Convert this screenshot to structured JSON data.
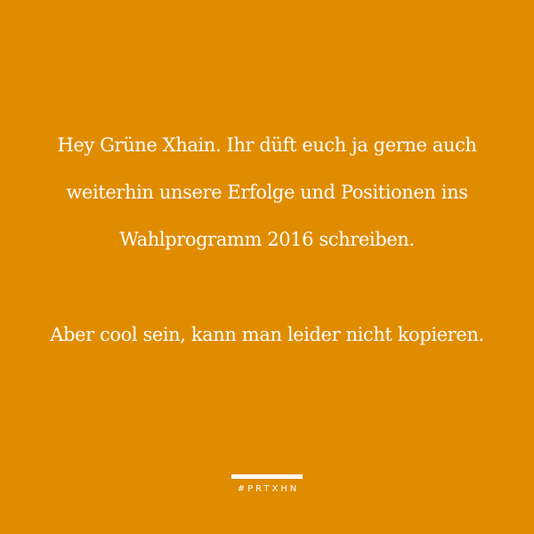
{
  "colors": {
    "background": "#E08C00",
    "text": "#FFFFFF"
  },
  "quote": {
    "paragraph1": [
      "Hey Grüne Xhain. Ihr düft euch ja gerne auch",
      "weiterhin unsere Erfolge und Positionen ins",
      "Wahlprogramm 2016 schreiben."
    ],
    "paragraph2": [
      "Aber cool sein, kann man leider nicht kopieren."
    ]
  },
  "footer": {
    "hashtag": "#PRTXHN"
  }
}
